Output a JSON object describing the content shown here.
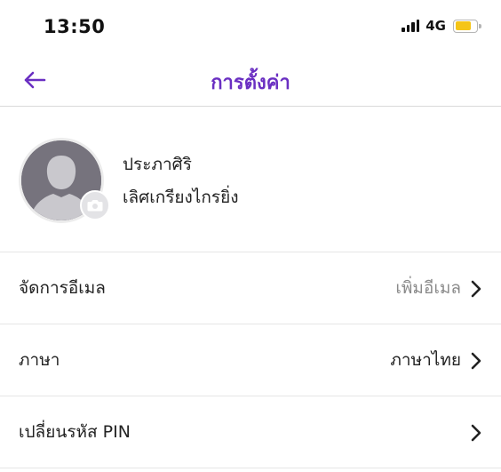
{
  "status_bar": {
    "time": "13:50",
    "network": "4G",
    "battery_level": 0.75,
    "battery_color": "#f5c518"
  },
  "nav": {
    "title": "การตั้งค่า",
    "back_icon": "arrow-left-icon",
    "accent_color": "#6a2fc2"
  },
  "profile": {
    "first_name": "ประภาศิริ",
    "last_name": "เลิศเกรียงไกรยิ่ง",
    "avatar_icon": "default-person-avatar",
    "badge_icon": "camera-icon"
  },
  "settings": [
    {
      "label": "จัดการอีเมล",
      "value": "เพิ่มอีเมล",
      "value_style": "muted"
    },
    {
      "label": "ภาษา",
      "value": "ภาษาไทย",
      "value_style": "dark"
    },
    {
      "label": "เปลี่ยนรหัส PIN",
      "value": "",
      "value_style": "dark"
    }
  ]
}
